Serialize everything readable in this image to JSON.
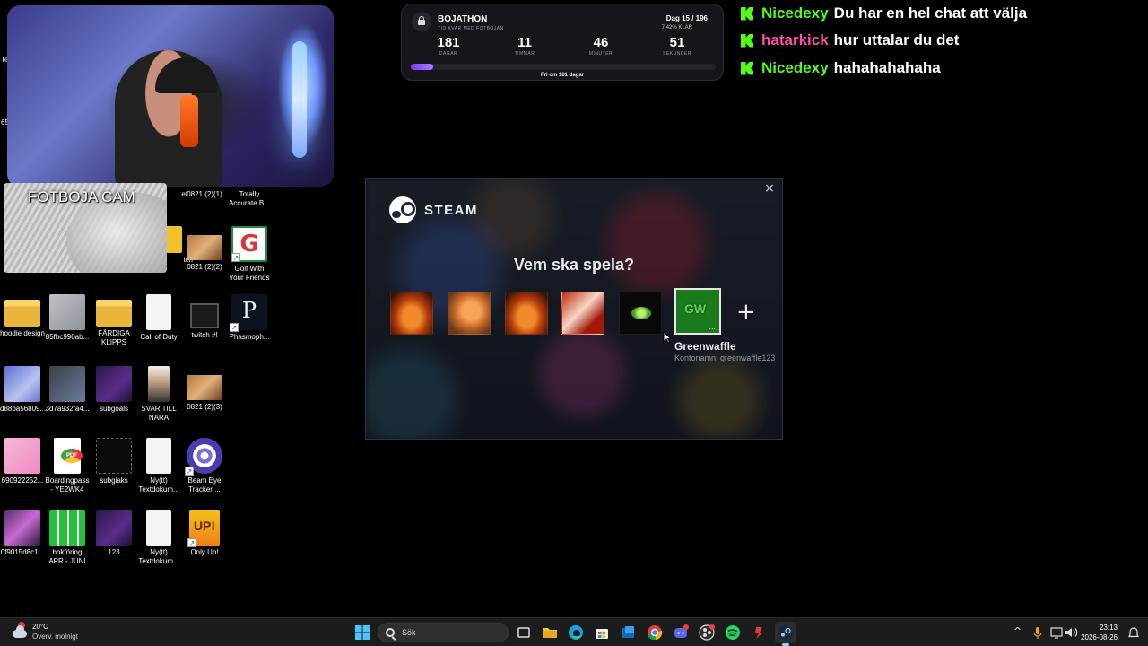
{
  "webcam": {
    "footcam_label": "FOTBOJA CAM"
  },
  "timer": {
    "title": "BOJATHON",
    "subtitle": "TID KVAR MED FOTBOJAN",
    "day": "Dag 15 / 196",
    "percent_label": "7.42% KLAR",
    "progress_fraction": 0.0742,
    "days": "181",
    "days_unit": "DAGAR",
    "hours": "11",
    "hours_unit": "TIMMAR",
    "minutes": "46",
    "minutes_unit": "MINUTER",
    "seconds": "51",
    "seconds_unit": "SEKUNDER",
    "free_in": "Fri om 181 dagar"
  },
  "chat": [
    {
      "user": "Nicedexy",
      "color": "#53fc18",
      "message": "Du har en hel chat att välja"
    },
    {
      "user": "hatarkick",
      "color": "#ff4fa8",
      "message": "hur uttalar du det"
    },
    {
      "user": "Nicedexy",
      "color": "#53fc18",
      "message": "hahahahahaha"
    }
  ],
  "desktop": {
    "icons": [
      {
        "label": "et"
      },
      {
        "label": "0821 (2)(1)"
      },
      {
        "label": "Totally Accurate B..."
      },
      {
        "label": "tch"
      },
      {
        "label": "0821 (2)(2)"
      },
      {
        "label": "Golf With Your Friends"
      },
      {
        "label": "hoodie design"
      },
      {
        "label": "85fbc990ab..."
      },
      {
        "label": "FÄRDIGA KLIPPS"
      },
      {
        "label": "Call of Duty"
      },
      {
        "label": "twitch #!"
      },
      {
        "label": "Phasmoph..."
      },
      {
        "label": "d88ba56809..."
      },
      {
        "label": "3d7a932fa4..."
      },
      {
        "label": "subgoals"
      },
      {
        "label": "SVAR TILL NARA"
      },
      {
        "label": "0821 (2)(3)"
      },
      {
        "label": "690922252..."
      },
      {
        "label": "Boardingpass - YE2WK4"
      },
      {
        "label": "subgiaks"
      },
      {
        "label": "Ny(tt) Textdokum..."
      },
      {
        "label": "Beam Eye Tracker ..."
      },
      {
        "label": "0f9015d8c1..."
      },
      {
        "label": "bokföring APR - JUNI"
      },
      {
        "label": "123"
      },
      {
        "label": "Ny(tt) Textdokum..."
      },
      {
        "label": "Only Up!"
      }
    ],
    "edge_labels": [
      "Te",
      "65"
    ]
  },
  "steam": {
    "brand": "STEAM",
    "close_icon": "×",
    "question": "Vem ska spela?",
    "add_icon": "+",
    "selected_name": "Greenwaffle",
    "selected_account": "Kontonamn: greenwaffle123",
    "avatar_dots": "..."
  },
  "taskbar": {
    "temperature": "20°C",
    "weather": "Överv. molnigt",
    "search_placeholder": "Sök",
    "time": "23:13",
    "date": "2026-08-26",
    "tray_chevron": "^",
    "accent": "#4cc2ff"
  }
}
